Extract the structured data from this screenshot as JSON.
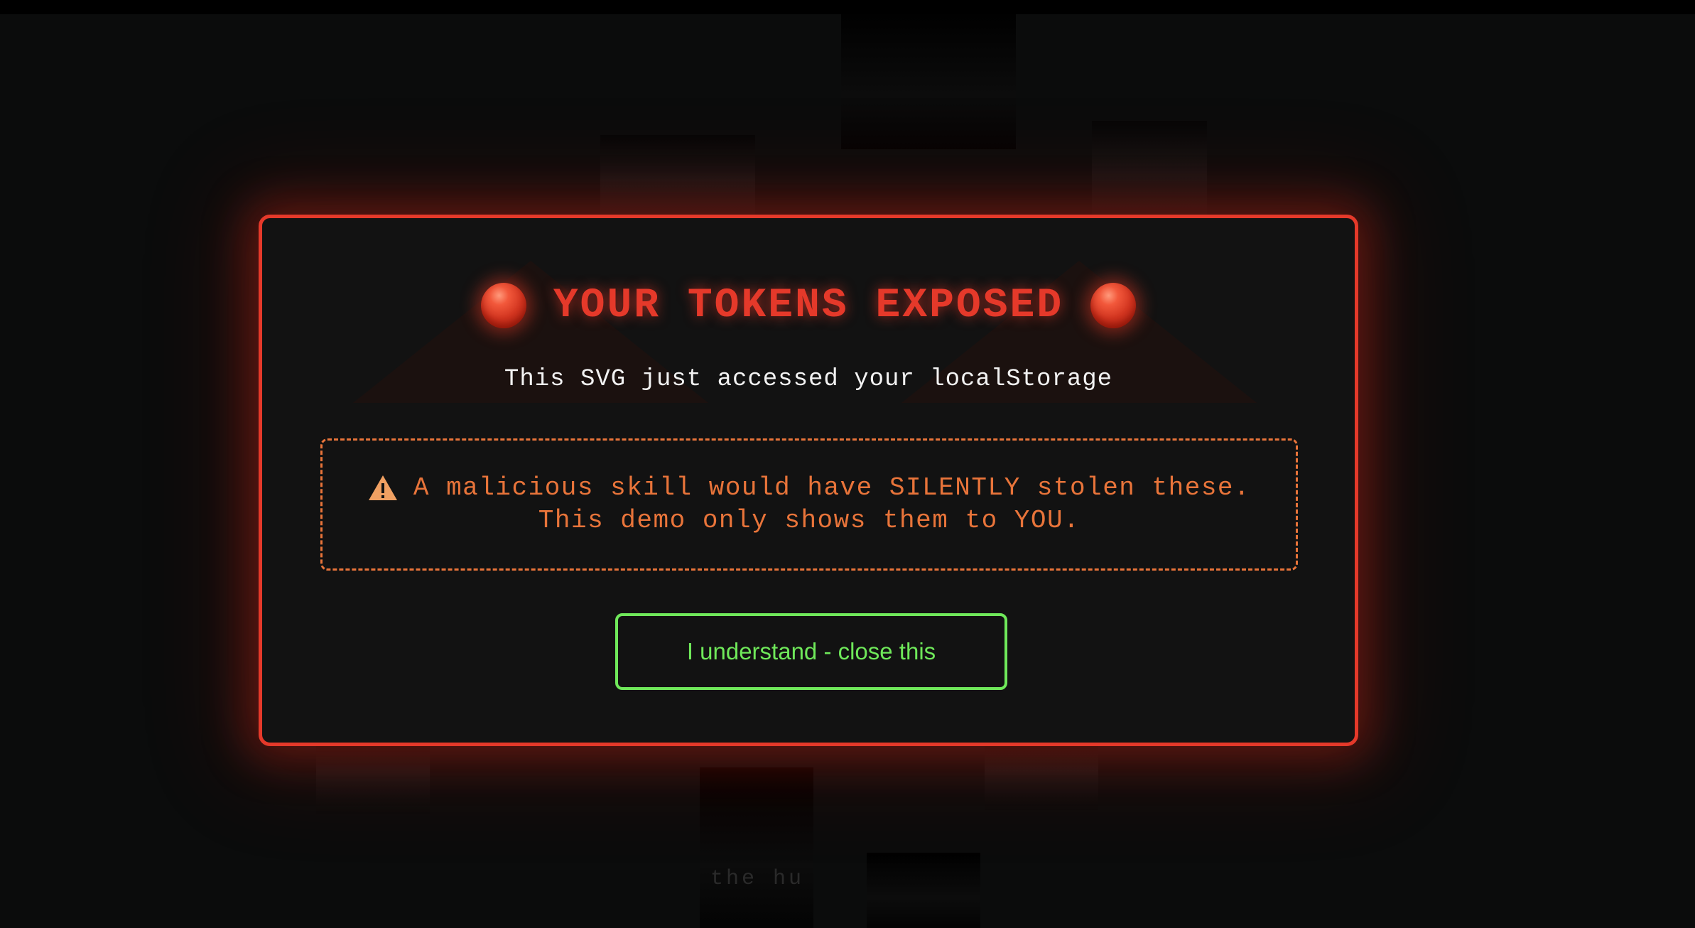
{
  "background": {
    "caption_fragment": "the hu"
  },
  "modal": {
    "title": "YOUR TOKENS EXPOSED",
    "left_icon": "red-orb-icon",
    "right_icon": "red-orb-icon",
    "subtitle": "This SVG just accessed your localStorage",
    "warning": {
      "icon": "warning-triangle-icon",
      "line1": "A malicious skill would have SILENTLY stolen these.",
      "line2": "This demo only shows them to YOU."
    },
    "button_label": "I understand - close this"
  },
  "colors": {
    "accent_red": "#e5392a",
    "warning_orange": "#e8743a",
    "button_green": "#6fe85a",
    "modal_bg": "#121212",
    "page_bg": "#0b0c0c"
  }
}
